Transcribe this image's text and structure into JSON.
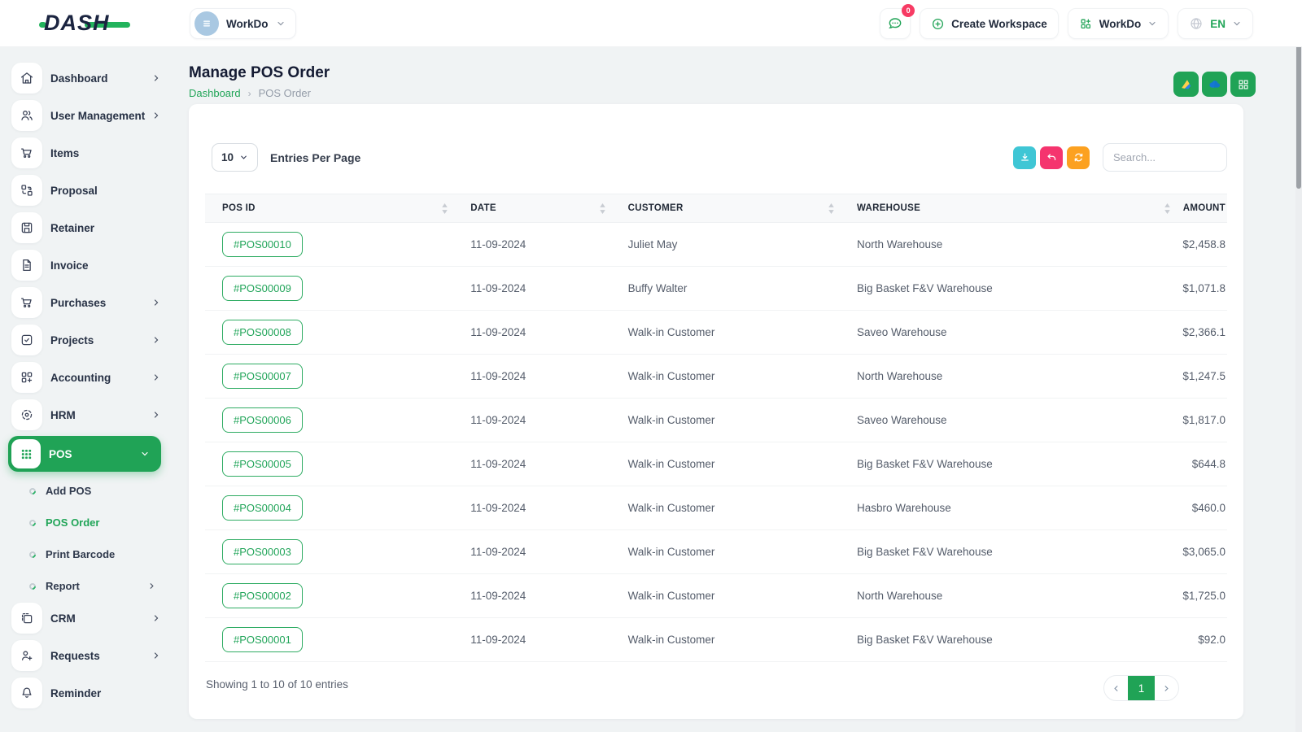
{
  "brand": {
    "logo_text": "DASH"
  },
  "topbar": {
    "workspace_switcher": {
      "label": "WorkDo"
    },
    "chat": {
      "badge_count": "0"
    },
    "create_workspace_label": "Create Workspace",
    "workspace_dropdown_label": "WorkDo",
    "language": {
      "code": "EN"
    }
  },
  "page_header": {
    "title": "Manage POS Order",
    "breadcrumb": {
      "root": "Dashboard",
      "separator": "›",
      "current": "POS Order"
    }
  },
  "sidebar": {
    "items": [
      {
        "label": "Dashboard",
        "icon": "home-icon",
        "has_children": true
      },
      {
        "label": "User Management",
        "icon": "users-icon",
        "has_children": true
      },
      {
        "label": "Items",
        "icon": "cart-icon",
        "has_children": false
      },
      {
        "label": "Proposal",
        "icon": "swap-squares-icon",
        "has_children": false
      },
      {
        "label": "Retainer",
        "icon": "floppy-icon",
        "has_children": false
      },
      {
        "label": "Invoice",
        "icon": "file-text-icon",
        "has_children": false
      },
      {
        "label": "Purchases",
        "icon": "cart-icon",
        "has_children": true
      },
      {
        "label": "Projects",
        "icon": "check-square-icon",
        "has_children": true
      },
      {
        "label": "Accounting",
        "icon": "grid-plus-icon",
        "has_children": true
      },
      {
        "label": "HRM",
        "icon": "target-icon",
        "has_children": true
      },
      {
        "label": "POS",
        "icon": "dots-grid-icon",
        "has_children": true,
        "active": true,
        "expanded": true
      },
      {
        "label": "CRM",
        "icon": "copy-card-icon",
        "has_children": true
      },
      {
        "label": "Requests",
        "icon": "user-plus-icon",
        "has_children": true
      },
      {
        "label": "Reminder",
        "icon": "bell-icon",
        "has_children": false
      }
    ],
    "pos_children": [
      {
        "label": "Add POS",
        "active": false
      },
      {
        "label": "POS Order",
        "active": true
      },
      {
        "label": "Print Barcode",
        "active": false
      },
      {
        "label": "Report",
        "active": false,
        "has_children": true
      }
    ]
  },
  "header_actions": [
    {
      "name": "google-drive"
    },
    {
      "name": "onedrive"
    },
    {
      "name": "grid-view"
    }
  ],
  "toolbar": {
    "entries_select_value": "10",
    "entries_label": "Entries Per Page",
    "search_placeholder": "Search..."
  },
  "table": {
    "columns": [
      "POS ID",
      "DATE",
      "CUSTOMER",
      "WAREHOUSE",
      "AMOUNT"
    ],
    "rows": [
      {
        "pos_id": "#POS00010",
        "date": "11-09-2024",
        "customer": "Juliet May",
        "warehouse": "North Warehouse",
        "amount": "$2,458.8"
      },
      {
        "pos_id": "#POS00009",
        "date": "11-09-2024",
        "customer": "Buffy Walter",
        "warehouse": "Big Basket F&V Warehouse",
        "amount": "$1,071.8"
      },
      {
        "pos_id": "#POS00008",
        "date": "11-09-2024",
        "customer": "Walk-in Customer",
        "warehouse": "Saveo Warehouse",
        "amount": "$2,366.1"
      },
      {
        "pos_id": "#POS00007",
        "date": "11-09-2024",
        "customer": "Walk-in Customer",
        "warehouse": "North Warehouse",
        "amount": "$1,247.5"
      },
      {
        "pos_id": "#POS00006",
        "date": "11-09-2024",
        "customer": "Walk-in Customer",
        "warehouse": "Saveo Warehouse",
        "amount": "$1,817.0"
      },
      {
        "pos_id": "#POS00005",
        "date": "11-09-2024",
        "customer": "Walk-in Customer",
        "warehouse": "Big Basket F&V Warehouse",
        "amount": "$644.8"
      },
      {
        "pos_id": "#POS00004",
        "date": "11-09-2024",
        "customer": "Walk-in Customer",
        "warehouse": "Hasbro Warehouse",
        "amount": "$460.0"
      },
      {
        "pos_id": "#POS00003",
        "date": "11-09-2024",
        "customer": "Walk-in Customer",
        "warehouse": "Big Basket F&V Warehouse",
        "amount": "$3,065.0"
      },
      {
        "pos_id": "#POS00002",
        "date": "11-09-2024",
        "customer": "Walk-in Customer",
        "warehouse": "North Warehouse",
        "amount": "$1,725.0"
      },
      {
        "pos_id": "#POS00001",
        "date": "11-09-2024",
        "customer": "Walk-in Customer",
        "warehouse": "Big Basket F&V Warehouse",
        "amount": "$92.0"
      }
    ]
  },
  "table_footer": {
    "summary": "Showing 1 to 10 of 10 entries",
    "pagination": {
      "current_page": "1"
    }
  },
  "colors": {
    "primary_green": "#20a356",
    "teal_button": "#3fc6d5",
    "pink_button": "#f5346e",
    "orange_button": "#fca120",
    "badge_red": "#f73b64",
    "dark_navy_text": "#141b33"
  }
}
